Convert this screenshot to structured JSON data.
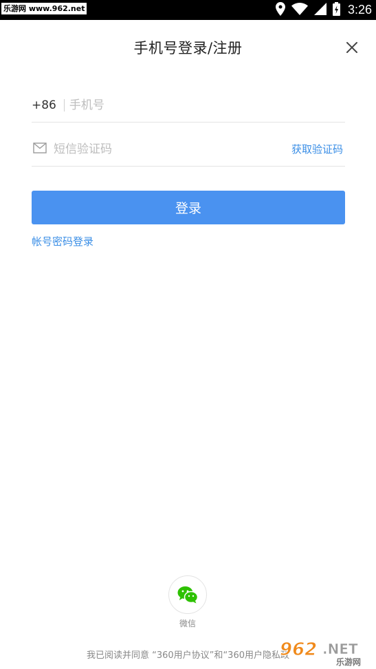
{
  "status_bar": {
    "watermark": "乐游网 www.962.net",
    "time": "3:26",
    "icons": [
      "location-icon",
      "wifi-icon",
      "signal-icon",
      "battery-icon"
    ]
  },
  "header": {
    "title": "手机号登录/注册",
    "close_icon": "close-icon"
  },
  "phone": {
    "country_code": "+86",
    "placeholder": "手机号",
    "value": ""
  },
  "sms": {
    "icon": "mail-icon",
    "placeholder": "短信验证码",
    "value": "",
    "get_code_label": "获取验证码"
  },
  "login_button_label": "登录",
  "password_login_label": "帐号密码登录",
  "social": {
    "wechat_label": "微信",
    "wechat_icon": "wechat-icon"
  },
  "agreement": {
    "prefix": "我已阅读并同意 ",
    "user_agreement": "“360用户协议”",
    "and": "和",
    "privacy_policy": "“360用户隐私政"
  },
  "site_watermark": {
    "number": "962",
    "suffix": ".NET",
    "name": "乐游网"
  },
  "colors": {
    "accent": "#4a92f0",
    "link": "#3a8ee6",
    "divider": "#e3e3e3",
    "wechat": "#2dc100"
  }
}
